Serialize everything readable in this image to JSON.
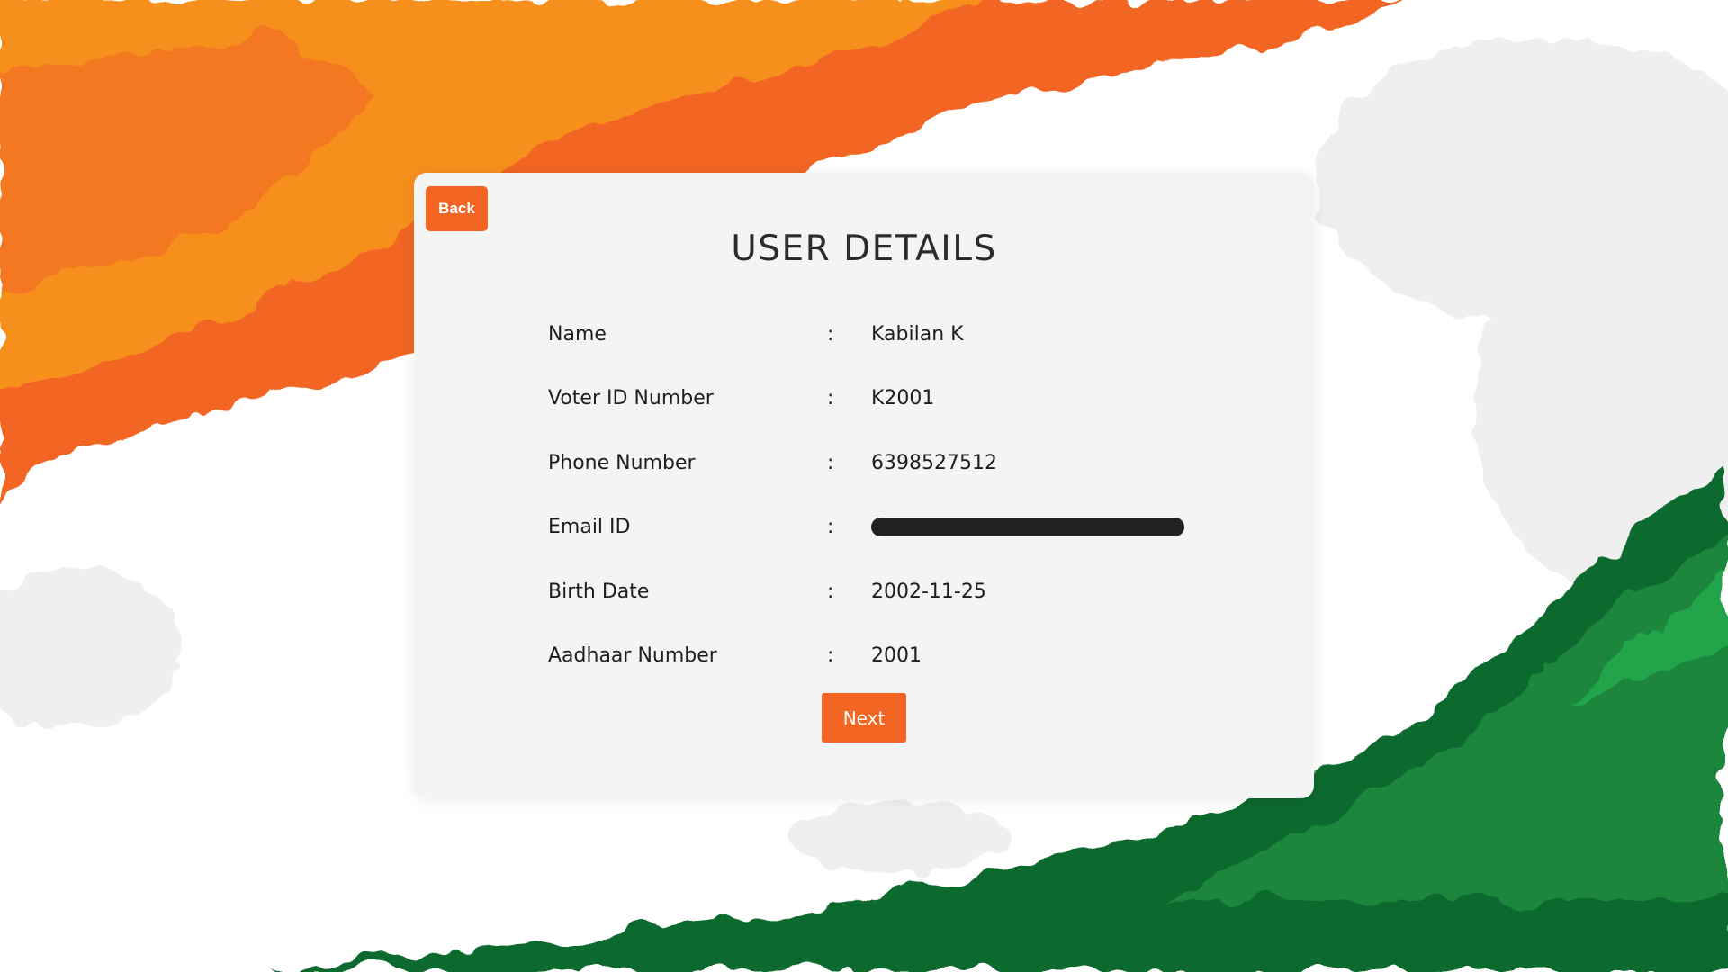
{
  "colors": {
    "saffron": "#f26522",
    "saffron_light": "#f7941d",
    "green_dark": "#0e6b2d",
    "green_mid": "#1e8a3e",
    "green_light": "#22a94f",
    "card_bg": "#f4f4f4"
  },
  "back_button": {
    "label": "Back"
  },
  "card": {
    "title": "USER DETAILS",
    "rows": [
      {
        "label": "Name",
        "separator": ":",
        "value": "Kabilan K"
      },
      {
        "label": "Voter ID Number",
        "separator": ":",
        "value": "K2001"
      },
      {
        "label": "Phone Number",
        "separator": ":",
        "value": "6398527512"
      },
      {
        "label": "Email ID",
        "separator": ":",
        "value": "",
        "redacted": true
      },
      {
        "label": "Birth Date",
        "separator": ":",
        "value": "2002-11-25"
      },
      {
        "label": "Aadhaar Number",
        "separator": ":",
        "value": "2001"
      }
    ]
  },
  "next_button": {
    "label": "Next"
  }
}
